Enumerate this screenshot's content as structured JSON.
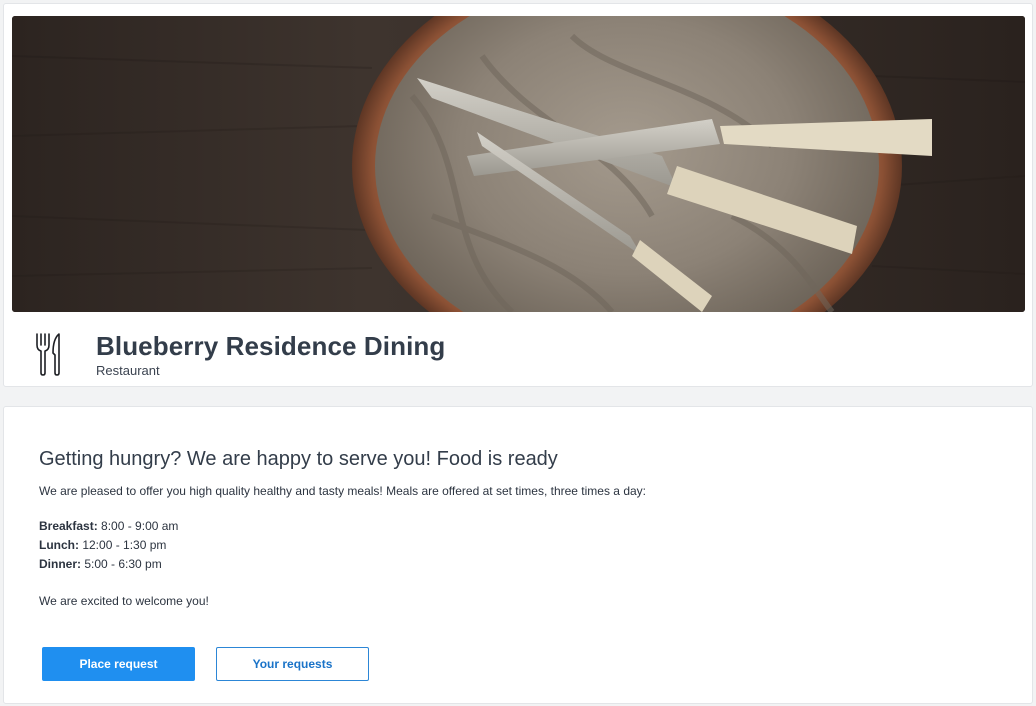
{
  "colors": {
    "accent": "#1f8ff0",
    "accent_text": "#1a73c8",
    "page_background": "#f2f3f4",
    "card_background": "#ffffff",
    "heading_text": "#333d4a"
  },
  "hero": {
    "image_name": "knives-in-wooden-bowl-photo"
  },
  "header": {
    "icon": "fork-knife-icon",
    "title": "Blueberry Residence Dining",
    "subtitle": "Restaurant"
  },
  "content": {
    "headline": "Getting hungry? We are happy to serve you! Food is ready",
    "intro": "We are pleased to offer you high quality healthy and tasty meals! Meals are offered at set times, three times a day:",
    "hours": [
      {
        "label": "Breakfast:",
        "time": " 8:00 - 9:00 am"
      },
      {
        "label": "Lunch:",
        "time": " 12:00 - 1:30 pm"
      },
      {
        "label": "Dinner:",
        "time": " 5:00 - 6:30 pm"
      }
    ],
    "welcome": "We are excited to welcome you!"
  },
  "actions": {
    "place_request": "Place request",
    "your_requests": "Your requests"
  }
}
